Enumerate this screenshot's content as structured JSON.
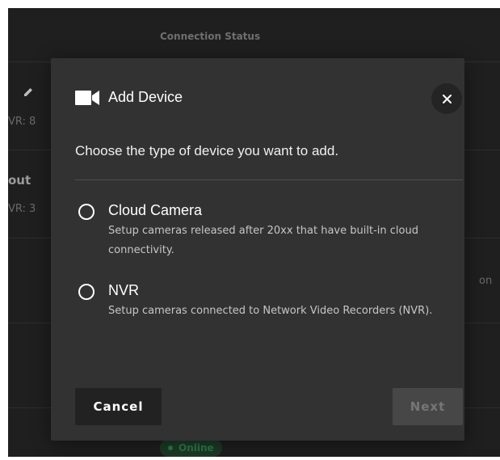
{
  "background": {
    "header_title": "Connection Status",
    "row1_nvr": "VR: 8",
    "row2_title": "out",
    "row2_nvr": "VR: 3",
    "row3_right": "on",
    "status_badge": "Online",
    "colors": {
      "status_online": "#2d7a45"
    }
  },
  "dialog": {
    "title": "Add Device",
    "title_icon": "video-camera-icon",
    "close_icon": "close-icon",
    "prompt": "Choose the type of device you want to add.",
    "options": [
      {
        "label": "Cloud Camera",
        "description": "Setup cameras released after 20xx that have built-in cloud connectivity.",
        "selected": false
      },
      {
        "label": "NVR",
        "description": "Setup cameras connected to Network Video Recorders (NVR).",
        "selected": false
      }
    ],
    "cancel_label": "Cancel",
    "next_label": "Next",
    "next_enabled": false
  }
}
